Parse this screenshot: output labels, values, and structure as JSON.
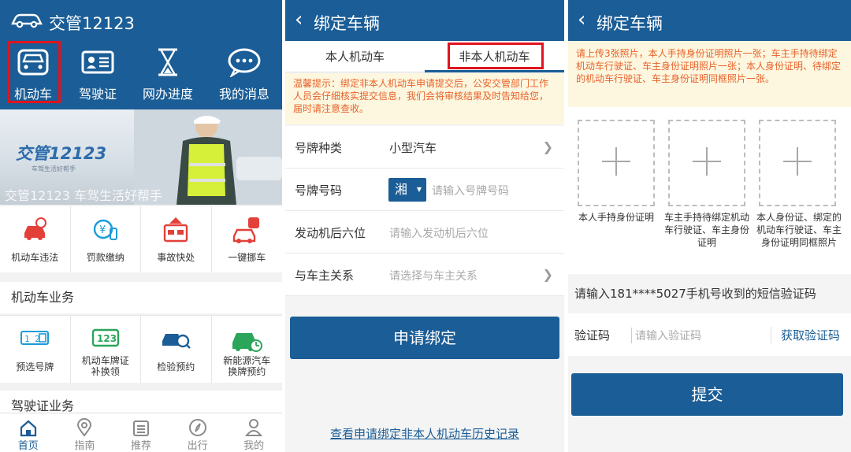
{
  "panel1": {
    "app_title": "交管12123",
    "quick_actions": [
      {
        "label": "机动车",
        "icon": "car-front-icon"
      },
      {
        "label": "驾驶证",
        "icon": "license-card-icon"
      },
      {
        "label": "网办进度",
        "icon": "hourglass-icon"
      },
      {
        "label": "我的消息",
        "icon": "message-bubble-icon"
      }
    ],
    "banner": {
      "title": "交管12123",
      "subtitle": "车驾生活好帮手",
      "caption": "交管12123 车驾生活好帮手"
    },
    "services": [
      {
        "label": "机动车违法",
        "icon": "car-violation-icon"
      },
      {
        "label": "罚款缴纳",
        "icon": "fine-payment-icon"
      },
      {
        "label": "事故快处",
        "icon": "accident-icon"
      },
      {
        "label": "一键挪车",
        "icon": "move-car-icon"
      }
    ],
    "vehicle_section_title": "机动车业务",
    "vehicle_services": [
      {
        "label": "预选号牌",
        "icon": "plate-select-icon"
      },
      {
        "label": "机动车牌证\n补换领",
        "icon": "plate-123-icon"
      },
      {
        "label": "检验预约",
        "icon": "inspection-icon"
      },
      {
        "label": "新能源汽车\n换牌预约",
        "icon": "ev-car-icon"
      }
    ],
    "license_section_title": "驾驶证业务",
    "tabbar": [
      {
        "label": "首页",
        "icon": "home-icon",
        "active": true
      },
      {
        "label": "指南",
        "icon": "location-pin-icon",
        "active": false
      },
      {
        "label": "推荐",
        "icon": "list-doc-icon",
        "active": false
      },
      {
        "label": "出行",
        "icon": "compass-icon",
        "active": false
      },
      {
        "label": "我的",
        "icon": "user-icon",
        "active": false
      }
    ]
  },
  "panel2": {
    "back": "‹",
    "title": "绑定车辆",
    "tabs": [
      "本人机动车",
      "非本人机动车"
    ],
    "notice": "温馨提示：绑定非本人机动车申请提交后，公安交管部门工作人员会仔细核实提交信息，我们会将审核结果及时告知给您，届时请注意查收。",
    "form": {
      "plate_type_label": "号牌种类",
      "plate_type_value": "小型汽车",
      "plate_no_label": "号牌号码",
      "province": "湘",
      "plate_no_placeholder": "请输入号牌号码",
      "engine_label": "发动机后六位",
      "engine_placeholder": "请输入发动机后六位",
      "relation_label": "与车主关系",
      "relation_placeholder": "请选择与车主关系"
    },
    "submit": "申请绑定",
    "history_link": "查看申请绑定非本人机动车历史记录"
  },
  "panel3": {
    "back": "‹",
    "title": "绑定车辆",
    "notice": "请上传3张照片，本人手持身份证明照片一张；车主手持待绑定机动车行驶证、车主身份证明照片一张；本人身份证明、待绑定的机动车行驶证、车主身份证明同框照片一张。",
    "photos": [
      {
        "label": "本人手持身份证明"
      },
      {
        "label": "车主手持待绑定机动车行驶证、车主身份证明"
      },
      {
        "label": "本人身份证、绑定的机动车行驶证、车主身份证明同框照片"
      }
    ],
    "sms_hint": "请输入181****5027手机号收到的短信验证码",
    "code_label": "验证码",
    "code_placeholder": "请输入验证码",
    "get_code": "获取验证码",
    "submit": "提交"
  },
  "colors": {
    "primary": "#1b5d96",
    "highlight_box": "#e0141e",
    "notice_text": "#e8612a",
    "notice_bg": "#fdf7df"
  }
}
